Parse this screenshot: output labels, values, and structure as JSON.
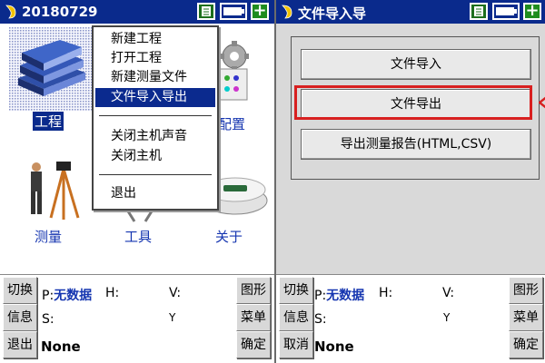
{
  "left": {
    "title": "20180729",
    "apps": {
      "project": "工程",
      "config": "配置",
      "survey": "测量",
      "tools": "工具",
      "about": "关于"
    },
    "menu": {
      "items": [
        "新建工程",
        "打开工程",
        "新建测量文件",
        "文件导入导出",
        "关闭主机声音",
        "关闭主机",
        "退出"
      ],
      "selected": "文件导入导出"
    },
    "status": {
      "left_buttons": [
        "切换",
        "信息",
        "退出"
      ],
      "right_buttons": [
        "图形",
        "菜单",
        "确定"
      ],
      "p_label": "P:",
      "p_value": "无数据",
      "h_label": "H:",
      "v_label": "V:",
      "s_label": "S:",
      "antenna": "Y",
      "solution": "None"
    }
  },
  "right": {
    "title": "文件导入导",
    "buttons": [
      "文件导入",
      "文件导出",
      "导出测量报告(HTML,CSV)"
    ],
    "highlighted": "文件导出",
    "status": {
      "left_buttons": [
        "切换",
        "信息",
        "取消"
      ],
      "right_buttons": [
        "图形",
        "菜单",
        "确定"
      ],
      "p_label": "P:",
      "p_value": "无数据",
      "h_label": "H:",
      "v_label": "V:",
      "s_label": "S:",
      "antenna": "Y",
      "solution": "None"
    }
  },
  "colors": {
    "titlebar": "#0a2a8c",
    "menu_selected": "#0b2a8e",
    "label_blue": "#1535b0",
    "highlight_red": "#d82020"
  },
  "icons": [
    "logo-icon",
    "sheet-icon",
    "battery-icon",
    "plus-icon",
    "books-icon",
    "gear-icon",
    "surveyor-icon",
    "gnss-receiver-icon",
    "antenna-icon"
  ]
}
